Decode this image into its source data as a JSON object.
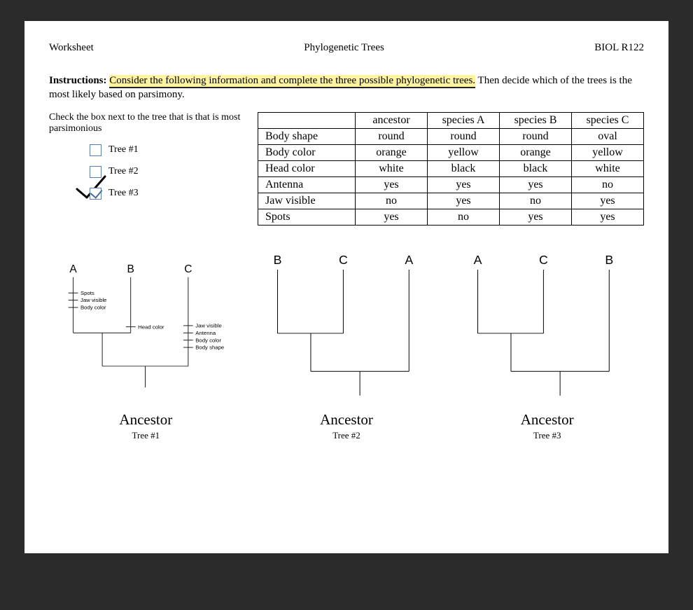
{
  "header": {
    "left": "Worksheet",
    "center": "Phylogenetic Trees",
    "right": "BIOL R122"
  },
  "instructions": {
    "lead": "Instructions:",
    "highlighted": "Consider the following information and complete the three possible phylogenetic trees.",
    "rest": " Then decide which of the trees is the most likely based on ",
    "tail": "parsimony."
  },
  "check": {
    "prompt": "Check the box next to the tree that is that is most parsimonious",
    "items": [
      {
        "label": "Tree #1",
        "checked": false,
        "handmark": false
      },
      {
        "label": "Tree #2",
        "checked": false,
        "handmark": false
      },
      {
        "label": "Tree #3",
        "checked": true,
        "handmark": true
      }
    ]
  },
  "table": {
    "cols": [
      "ancestor",
      "species A",
      "species B",
      "species C"
    ],
    "rows": [
      {
        "name": "Body shape",
        "vals": [
          "round",
          "round",
          "round",
          "oval"
        ]
      },
      {
        "name": "Body color",
        "vals": [
          "orange",
          "yellow",
          "orange",
          "yellow"
        ]
      },
      {
        "name": "Head color",
        "vals": [
          "white",
          "black",
          "black",
          "white"
        ]
      },
      {
        "name": "Antenna",
        "vals": [
          "yes",
          "yes",
          "yes",
          "no"
        ]
      },
      {
        "name": "Jaw visible",
        "vals": [
          "no",
          "yes",
          "no",
          "yes"
        ]
      },
      {
        "name": "Spots",
        "vals": [
          "yes",
          "no",
          "yes",
          "yes"
        ]
      }
    ]
  },
  "trees": {
    "ancestor_label": "Ancestor",
    "t1": {
      "name": "Tree #1",
      "tips": [
        "A",
        "B",
        "C"
      ],
      "branch_a_ticks": [
        "Spots",
        "Jaw visible",
        "Body color"
      ],
      "branch_b_ticks": [
        "Head color"
      ],
      "branch_c_ticks": [
        "Jaw visible",
        "Antenna",
        "Body color",
        "Body shape"
      ]
    },
    "t2": {
      "name": "Tree #2",
      "tips": [
        "B",
        "C",
        "A"
      ]
    },
    "t3": {
      "name": "Tree #3",
      "tips": [
        "A",
        "C",
        "B"
      ]
    }
  }
}
